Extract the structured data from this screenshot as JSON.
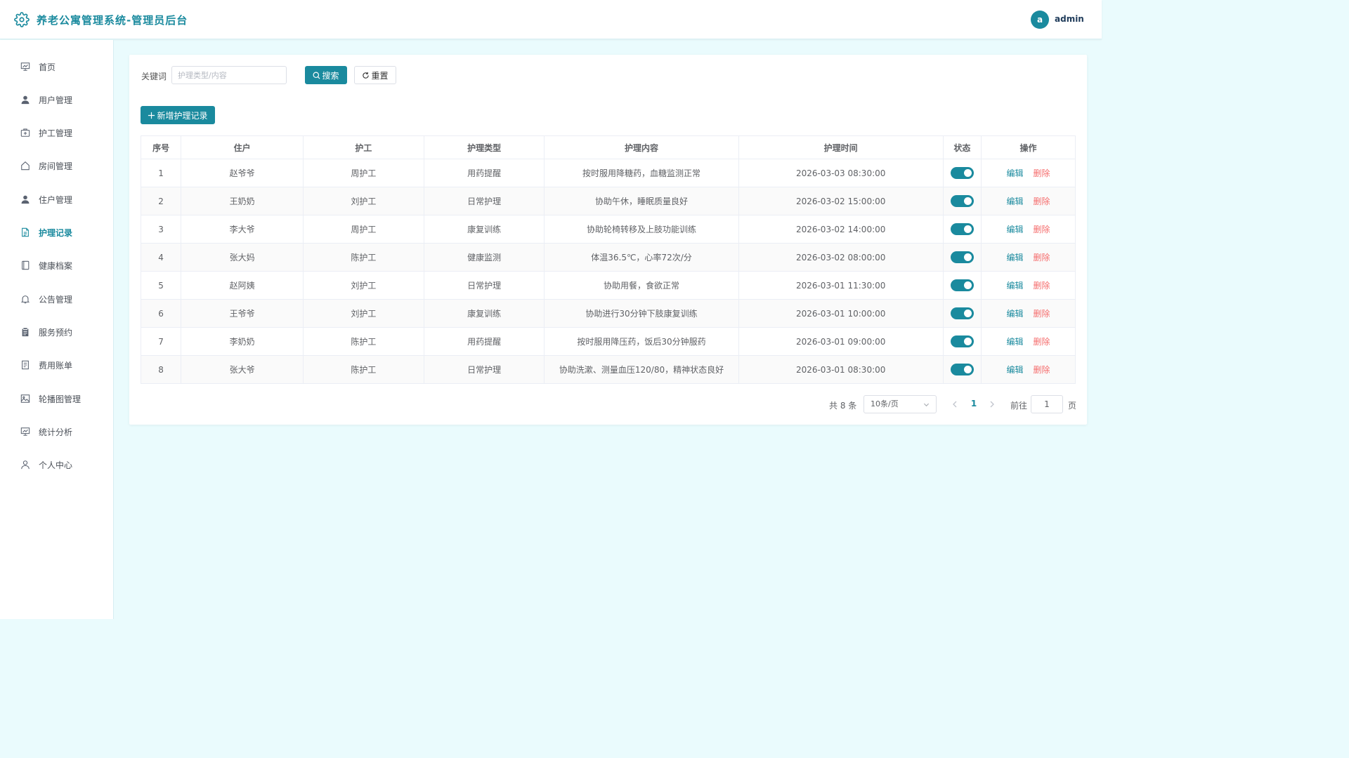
{
  "header": {
    "title": "养老公寓管理系统-管理员后台",
    "avatar_letter": "a",
    "username": "admin",
    "logo_icon": "gear-icon"
  },
  "sidebar": {
    "items": [
      {
        "label": "首页",
        "icon": "home-chart-icon",
        "active": false
      },
      {
        "label": "用户管理",
        "icon": "user-icon",
        "active": false
      },
      {
        "label": "护工管理",
        "icon": "medical-kit-icon",
        "active": false
      },
      {
        "label": "房间管理",
        "icon": "house-icon",
        "active": false
      },
      {
        "label": "住户管理",
        "icon": "user-icon",
        "active": false
      },
      {
        "label": "护理记录",
        "icon": "document-icon",
        "active": true
      },
      {
        "label": "健康档案",
        "icon": "notebook-icon",
        "active": false
      },
      {
        "label": "公告管理",
        "icon": "bell-icon",
        "active": false
      },
      {
        "label": "服务预约",
        "icon": "clipboard-icon",
        "active": false
      },
      {
        "label": "费用账单",
        "icon": "bill-icon",
        "active": false
      },
      {
        "label": "轮播图管理",
        "icon": "picture-icon",
        "active": false
      },
      {
        "label": "统计分析",
        "icon": "presentation-chart-icon",
        "active": false
      },
      {
        "label": "个人中心",
        "icon": "user-outline-icon",
        "active": false
      }
    ]
  },
  "search": {
    "label": "关键词",
    "placeholder": "护理类型/内容",
    "value": "",
    "search_label": "搜索",
    "reset_label": "重置"
  },
  "toolbar": {
    "add_label": "新增护理记录"
  },
  "table": {
    "columns": [
      "序号",
      "住户",
      "护工",
      "护理类型",
      "护理内容",
      "护理时间",
      "状态",
      "操作"
    ],
    "rows": [
      {
        "index": "1",
        "resident": "赵爷爷",
        "caregiver": "周护工",
        "type": "用药提醒",
        "content": "按时服用降糖药，血糖监测正常",
        "time": "2026-03-03 08:30:00",
        "status": true
      },
      {
        "index": "2",
        "resident": "王奶奶",
        "caregiver": "刘护工",
        "type": "日常护理",
        "content": "协助午休，睡眠质量良好",
        "time": "2026-03-02 15:00:00",
        "status": true
      },
      {
        "index": "3",
        "resident": "李大爷",
        "caregiver": "周护工",
        "type": "康复训练",
        "content": "协助轮椅转移及上肢功能训练",
        "time": "2026-03-02 14:00:00",
        "status": true
      },
      {
        "index": "4",
        "resident": "张大妈",
        "caregiver": "陈护工",
        "type": "健康监测",
        "content": "体温36.5℃，心率72次/分",
        "time": "2026-03-02 08:00:00",
        "status": true
      },
      {
        "index": "5",
        "resident": "赵阿姨",
        "caregiver": "刘护工",
        "type": "日常护理",
        "content": "协助用餐，食欲正常",
        "time": "2026-03-01 11:30:00",
        "status": true
      },
      {
        "index": "6",
        "resident": "王爷爷",
        "caregiver": "刘护工",
        "type": "康复训练",
        "content": "协助进行30分钟下肢康复训练",
        "time": "2026-03-01 10:00:00",
        "status": true
      },
      {
        "index": "7",
        "resident": "李奶奶",
        "caregiver": "陈护工",
        "type": "用药提醒",
        "content": "按时服用降压药，饭后30分钟服药",
        "time": "2026-03-01 09:00:00",
        "status": true
      },
      {
        "index": "8",
        "resident": "张大爷",
        "caregiver": "陈护工",
        "type": "日常护理",
        "content": "协助洗漱、测量血压120/80，精神状态良好",
        "time": "2026-03-01 08:30:00",
        "status": true
      }
    ],
    "edit_label": "编辑",
    "delete_label": "删除"
  },
  "pagination": {
    "total_text": "共 8 条",
    "page_size": "10条/页",
    "current_page": "1",
    "goto_label": "前往",
    "goto_value": "1",
    "page_suffix": "页"
  },
  "colors": {
    "primary": "#1a8a9e",
    "danger": "#f56c6c",
    "background": "#eafbfd"
  }
}
